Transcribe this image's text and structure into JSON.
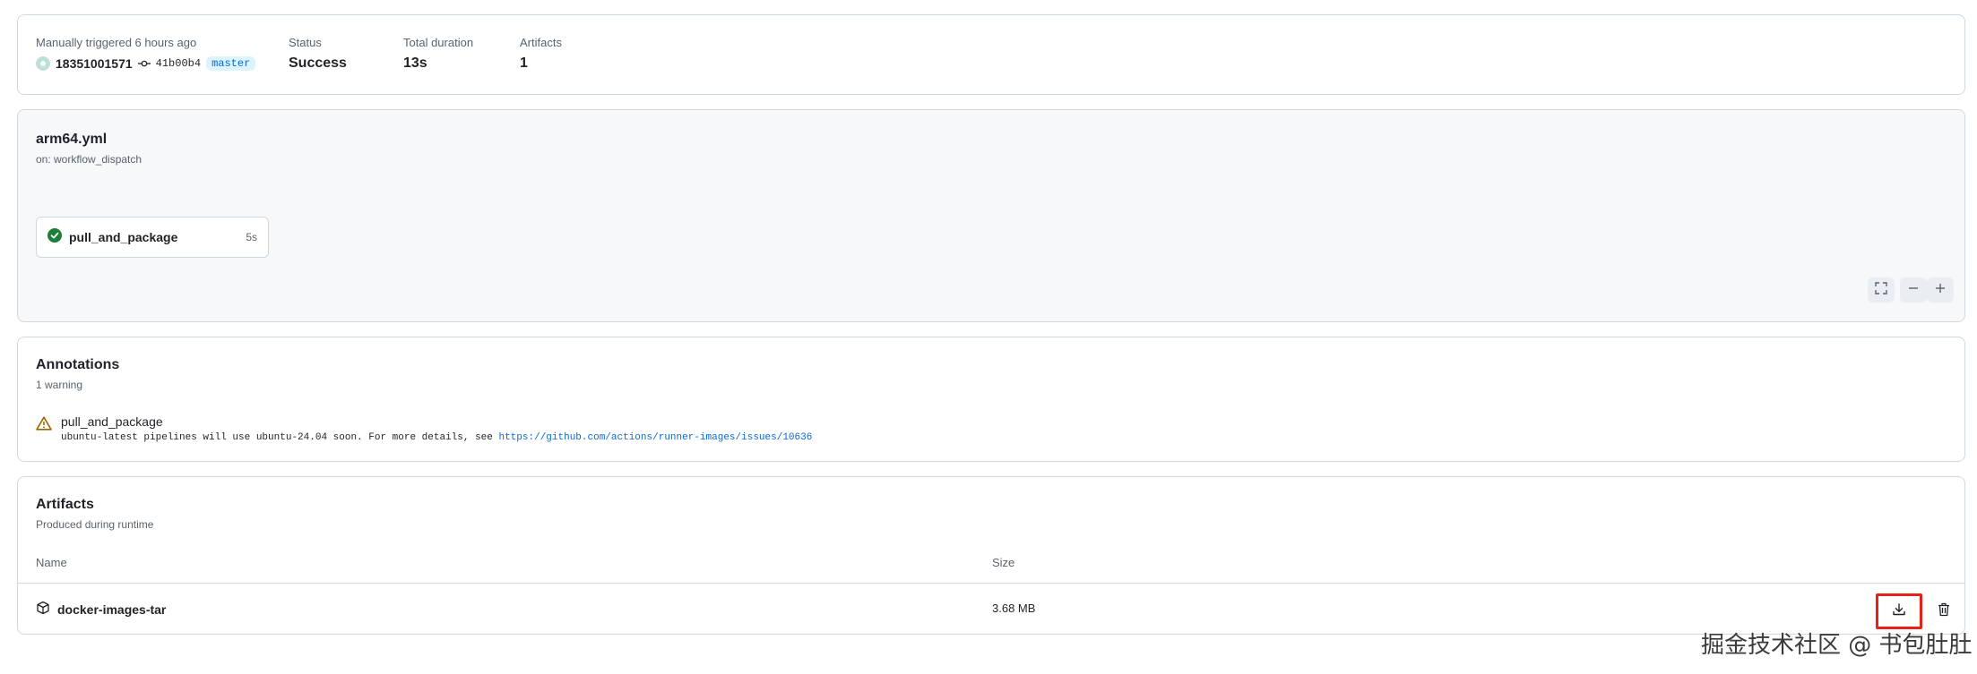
{
  "summary": {
    "trigger_label": "Manually triggered 6 hours ago",
    "actor": "18351001571",
    "commit_sha": "41b00b4",
    "branch": "master",
    "status_label": "Status",
    "status_value": "Success",
    "duration_label": "Total duration",
    "duration_value": "13s",
    "artifacts_label": "Artifacts",
    "artifacts_value": "1"
  },
  "workflow": {
    "file": "arm64.yml",
    "trigger": "on: workflow_dispatch",
    "job": {
      "name": "pull_and_package",
      "duration": "5s",
      "status_color": "#1a7f37"
    },
    "controls": [
      "fullscreen-icon",
      "zoom-out-icon",
      "zoom-in-icon"
    ]
  },
  "annotations": {
    "title": "Annotations",
    "count": "1 warning",
    "items": [
      {
        "job": "pull_and_package",
        "message": "ubuntu-latest pipelines will use ubuntu-24.04 soon. For more details, see ",
        "link": "https://github.com/actions/runner-images/issues/10636",
        "icon": "warning-icon",
        "icon_color": "#9a6700"
      }
    ]
  },
  "artifacts": {
    "title": "Artifacts",
    "subtitle": "Produced during runtime",
    "columns": [
      "Name",
      "Size"
    ],
    "rows": [
      {
        "name": "docker-images-tar",
        "size": "3.68 MB"
      }
    ]
  },
  "watermark": "掘金技术社区 @ 书包肚肚",
  "colors": {
    "accent": "#0969da",
    "success": "#1a7f37",
    "warning": "#9a6700",
    "highlight": "#e8201a"
  }
}
